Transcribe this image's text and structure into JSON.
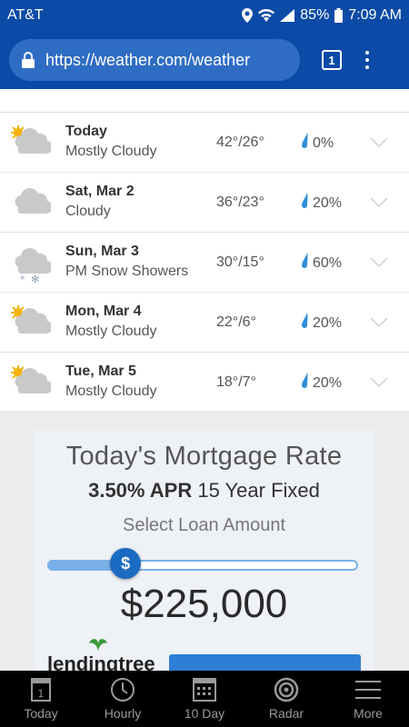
{
  "status": {
    "carrier": "AT&T",
    "battery": "85%",
    "time": "7:09 AM"
  },
  "browser": {
    "url": "https://weather.com/weather",
    "tab_count": "1"
  },
  "forecast": [
    {
      "day": "Today",
      "condition": "Mostly Cloudy",
      "temps": "42°/26°",
      "precip": "0%",
      "icon": "partly-cloudy-icon"
    },
    {
      "day": "Sat, Mar 2",
      "condition": "Cloudy",
      "temps": "36°/23°",
      "precip": "20%",
      "icon": "cloudy-icon"
    },
    {
      "day": "Sun, Mar 3",
      "condition": "PM Snow Showers",
      "temps": "30°/15°",
      "precip": "60%",
      "icon": "snow-showers-icon"
    },
    {
      "day": "Mon, Mar 4",
      "condition": "Mostly Cloudy",
      "temps": "22°/6°",
      "precip": "20%",
      "icon": "partly-cloudy-icon"
    },
    {
      "day": "Tue, Mar 5",
      "condition": "Mostly Cloudy",
      "temps": "18°/7°",
      "precip": "20%",
      "icon": "partly-cloudy-icon"
    }
  ],
  "ad": {
    "title": "Today's Mortgage Rate",
    "rate_bold": "3.50% APR",
    "rate_rest": " 15 Year Fixed",
    "select_label": "Select Loan Amount",
    "slider_glyph": "$",
    "slider_fraction": 0.24,
    "amount": "$225,000",
    "brand": "lendingtree"
  },
  "nav": [
    {
      "label": "Today",
      "icon": "today-calendar-icon"
    },
    {
      "label": "Hourly",
      "icon": "clock-icon"
    },
    {
      "label": "10 Day",
      "icon": "calendar-grid-icon"
    },
    {
      "label": "Radar",
      "icon": "radar-icon"
    },
    {
      "label": "More",
      "icon": "hamburger-menu-icon"
    }
  ],
  "colors": {
    "brand_blue": "#0b4aa6",
    "precip_drop": "#2f8fd6",
    "sun": "#f5b40a"
  }
}
